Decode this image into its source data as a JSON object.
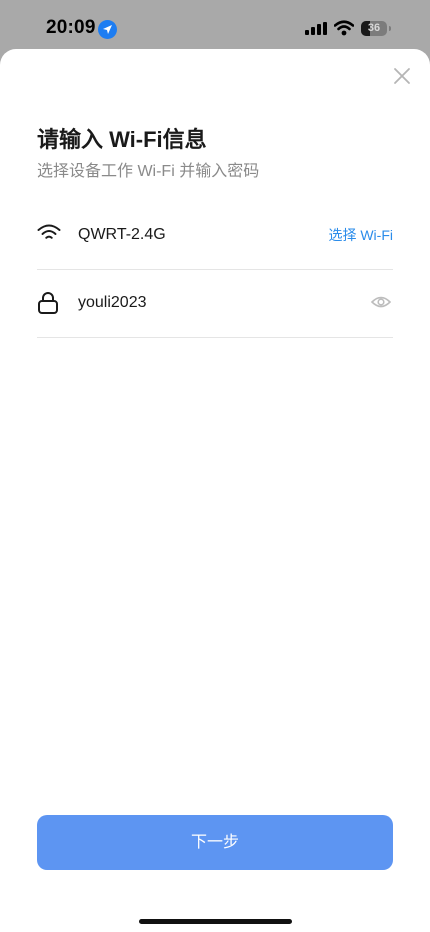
{
  "status_bar": {
    "time": "20:09",
    "battery_level": "36",
    "battery_fraction": 0.36,
    "location_icon_color": "#1d7df2"
  },
  "sheet": {
    "title": "请输入 Wi-Fi信息",
    "subtitle": "选择设备工作 Wi-Fi 并输入密码",
    "wifi_field": {
      "icon": "wifi-icon",
      "value": "QWRT-2.4G",
      "action_label": "选择 Wi-Fi"
    },
    "password_field": {
      "icon": "lock-icon",
      "value": "youli2023",
      "toggle_icon": "eye-icon"
    },
    "next_button_label": "下一步"
  },
  "colors": {
    "accent": "#2b8cea",
    "button_bg": "#5d95f2",
    "backdrop": "#a9a9a9"
  }
}
